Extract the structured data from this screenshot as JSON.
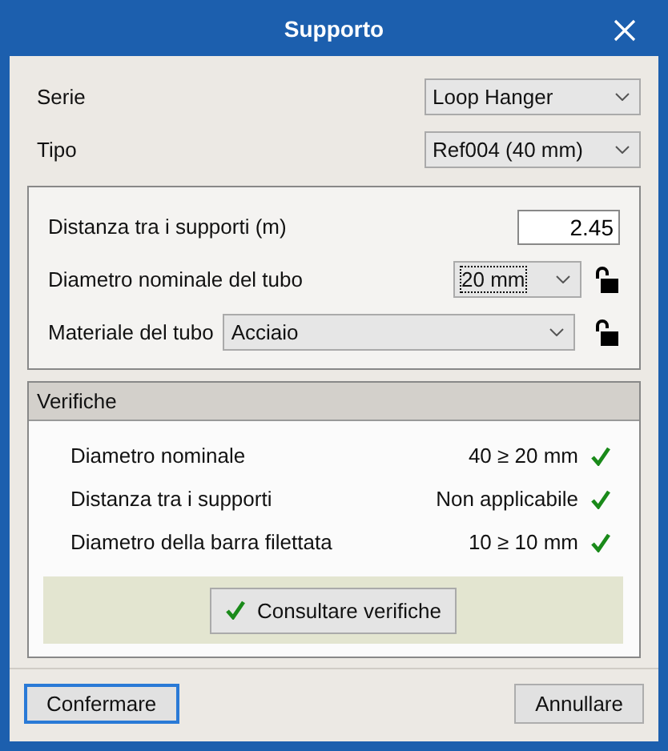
{
  "window": {
    "title": "Supporto"
  },
  "header_fields": [
    {
      "label": "Serie",
      "value": "Loop Hanger"
    },
    {
      "label": "Tipo",
      "value": "Ref004 (40 mm)"
    }
  ],
  "pipe": {
    "distance": {
      "label": "Distanza tra i supporti (m)",
      "value": "2.45"
    },
    "diameter": {
      "label": "Diametro nominale del tubo",
      "value": "20 mm",
      "focused": true
    },
    "material": {
      "label": "Materiale del tubo",
      "value": "Acciaio"
    }
  },
  "checks": {
    "title": "Verifiche",
    "rows": [
      {
        "label": "Diametro nominale",
        "result": "40 ≥ 20 mm",
        "passed": true
      },
      {
        "label": "Distanza tra i supporti",
        "result": "Non applicabile",
        "passed": true
      },
      {
        "label": "Diametro della barra filettata",
        "result": "10 ≥ 10 mm",
        "passed": true
      }
    ],
    "button": "Consultare verifiche"
  },
  "buttons": [
    {
      "label": "Confermare",
      "default": true
    },
    {
      "label": "Annullare",
      "default": false
    }
  ]
}
